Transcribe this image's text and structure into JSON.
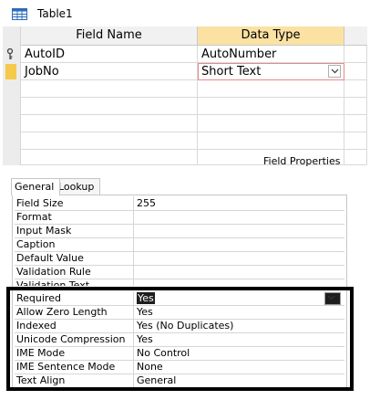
{
  "window": {
    "title": "Table1",
    "icon": "table-icon"
  },
  "grid": {
    "headers": {
      "field_name": "Field Name",
      "data_type": "Data Type"
    },
    "rows": [
      {
        "field_name": "AutoID",
        "data_type": "AutoNumber",
        "marker": "key-icon"
      },
      {
        "field_name": "JobNo",
        "data_type": "Short Text",
        "marker": "current-row"
      }
    ]
  },
  "field_properties_label": "Field Properties",
  "tabs": {
    "general": "General",
    "lookup": "Lookup"
  },
  "properties": [
    {
      "name": "Field Size",
      "value": "255"
    },
    {
      "name": "Format",
      "value": ""
    },
    {
      "name": "Input Mask",
      "value": ""
    },
    {
      "name": "Caption",
      "value": ""
    },
    {
      "name": "Default Value",
      "value": ""
    },
    {
      "name": "Validation Rule",
      "value": ""
    },
    {
      "name": "Validation Text",
      "value": ""
    },
    {
      "name": "Required",
      "value": "Yes"
    },
    {
      "name": "Allow Zero Length",
      "value": "Yes"
    },
    {
      "name": "Indexed",
      "value": "Yes (No Duplicates)"
    },
    {
      "name": "Unicode Compression",
      "value": "Yes"
    },
    {
      "name": "IME Mode",
      "value": "No Control"
    },
    {
      "name": "IME Sentence Mode",
      "value": "None"
    },
    {
      "name": "Text Align",
      "value": "General"
    }
  ],
  "colors": {
    "header_active": "#fbe2a3",
    "row_marker": "#f5c94a",
    "highlight_border": "#000000"
  }
}
